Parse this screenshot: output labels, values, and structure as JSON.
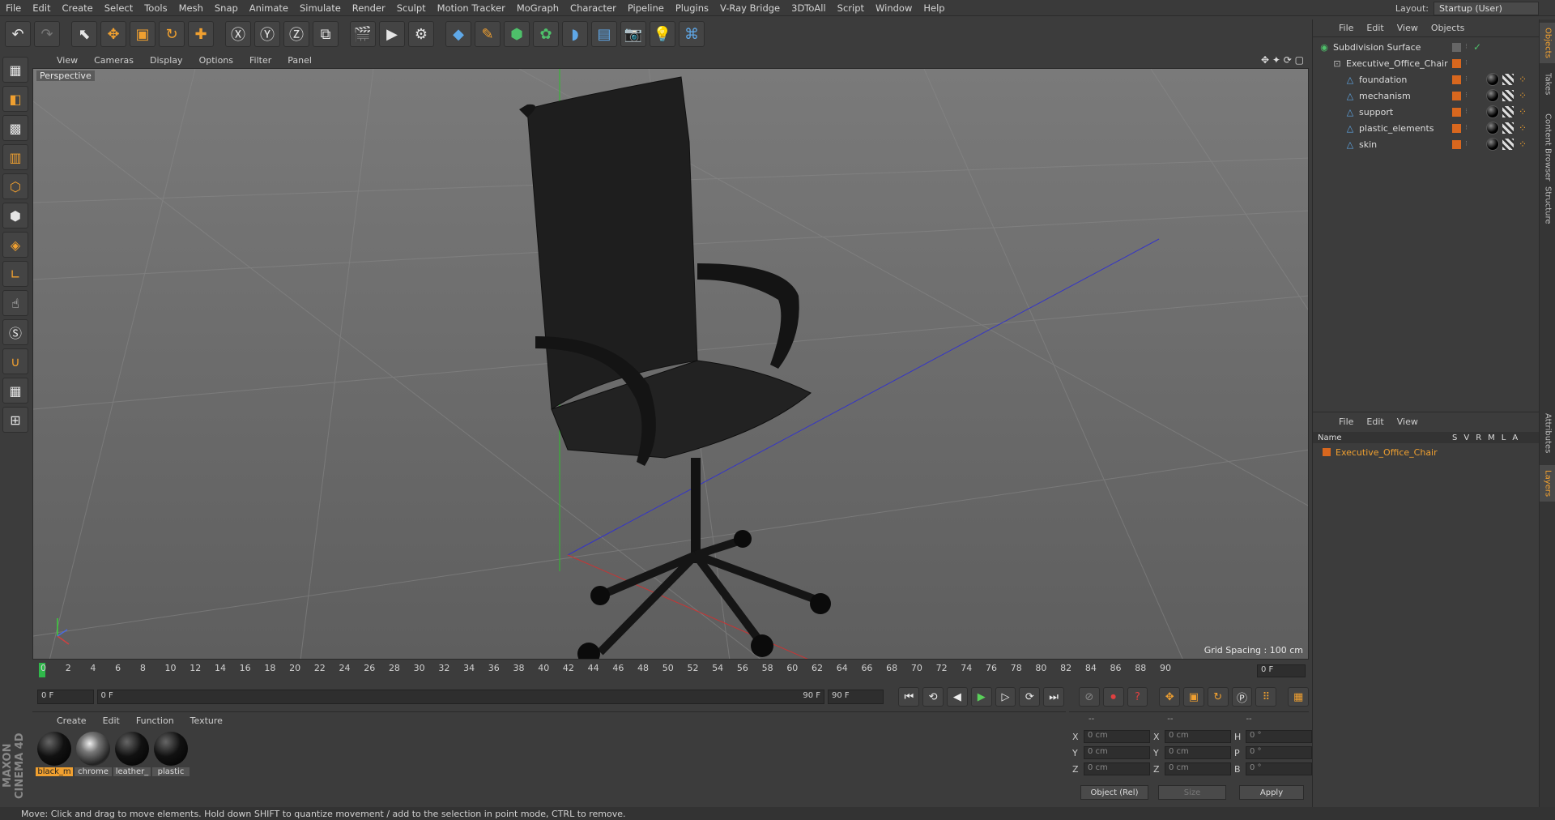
{
  "menubar": {
    "items": [
      "File",
      "Edit",
      "Create",
      "Select",
      "Tools",
      "Mesh",
      "Snap",
      "Animate",
      "Simulate",
      "Render",
      "Sculpt",
      "Motion Tracker",
      "MoGraph",
      "Character",
      "Pipeline",
      "Plugins",
      "V-Ray Bridge",
      "3DToAll",
      "Script",
      "Window",
      "Help"
    ],
    "layout_label": "Layout:",
    "layout_value": "Startup (User)"
  },
  "viewport": {
    "menu": [
      "View",
      "Cameras",
      "Display",
      "Options",
      "Filter",
      "Panel"
    ],
    "label": "Perspective",
    "grid_spacing": "Grid Spacing : 100 cm",
    "nav_icons": "✥ ✦ ⟳ ▢"
  },
  "timeline": {
    "ticks": [
      "0",
      "2",
      "4",
      "6",
      "8",
      "10",
      "12",
      "14",
      "16",
      "18",
      "20",
      "22",
      "24",
      "26",
      "28",
      "30",
      "32",
      "34",
      "36",
      "38",
      "40",
      "42",
      "44",
      "46",
      "48",
      "50",
      "52",
      "54",
      "56",
      "58",
      "60",
      "62",
      "64",
      "66",
      "68",
      "70",
      "72",
      "74",
      "76",
      "78",
      "80",
      "82",
      "84",
      "86",
      "88",
      "90"
    ],
    "current_frame": "0 F"
  },
  "transport": {
    "start": "0 F",
    "range_start": "0 F",
    "range_end": "90 F",
    "end": "90 F"
  },
  "materials": {
    "menu": [
      "Create",
      "Edit",
      "Function",
      "Texture"
    ],
    "items": [
      {
        "label": "black_m",
        "selected": true,
        "kind": "black"
      },
      {
        "label": "chrome",
        "selected": false,
        "kind": "chrome"
      },
      {
        "label": "leather_",
        "selected": false,
        "kind": "black"
      },
      {
        "label": "plastic",
        "selected": false,
        "kind": "black"
      }
    ]
  },
  "coords": {
    "header": [
      "--",
      "--",
      "--"
    ],
    "rows": [
      {
        "a1": "X",
        "v1": "0 cm",
        "a2": "X",
        "v2": "0 cm",
        "a3": "H",
        "v3": "0 °"
      },
      {
        "a1": "Y",
        "v1": "0 cm",
        "a2": "Y",
        "v2": "0 cm",
        "a3": "P",
        "v3": "0 °"
      },
      {
        "a1": "Z",
        "v1": "0 cm",
        "a2": "Z",
        "v2": "0 cm",
        "a3": "B",
        "v3": "0 °"
      }
    ],
    "mode": "Object (Rel)",
    "size": "Size",
    "apply": "Apply"
  },
  "objects": {
    "menu": [
      "File",
      "Edit",
      "View",
      "Objects"
    ],
    "items": [
      {
        "name": "Subdivision Surface",
        "level": 0,
        "icon": "subdivision-icon"
      },
      {
        "name": "Executive_Office_Chair",
        "level": 1,
        "icon": "null-icon"
      },
      {
        "name": "foundation",
        "level": 2,
        "icon": "polygon-icon"
      },
      {
        "name": "mechanism",
        "level": 2,
        "icon": "polygon-icon"
      },
      {
        "name": "support",
        "level": 2,
        "icon": "polygon-icon"
      },
      {
        "name": "plastic_elements",
        "level": 2,
        "icon": "polygon-icon"
      },
      {
        "name": "skin",
        "level": 2,
        "icon": "polygon-icon"
      }
    ]
  },
  "layers": {
    "menu": [
      "File",
      "Edit",
      "View"
    ],
    "header_name": "Name",
    "header_cols": [
      "S",
      "V",
      "R",
      "M",
      "L",
      "A"
    ],
    "row": "Executive_Office_Chair"
  },
  "right_tabs": [
    "Objects",
    "Takes",
    "Content Browser",
    "Structure",
    "Attributes",
    "Layers"
  ],
  "status": "Move: Click and drag to move elements. Hold down SHIFT to quantize movement / add to the selection in point mode, CTRL to remove.",
  "logo": "MAXON CINEMA 4D"
}
